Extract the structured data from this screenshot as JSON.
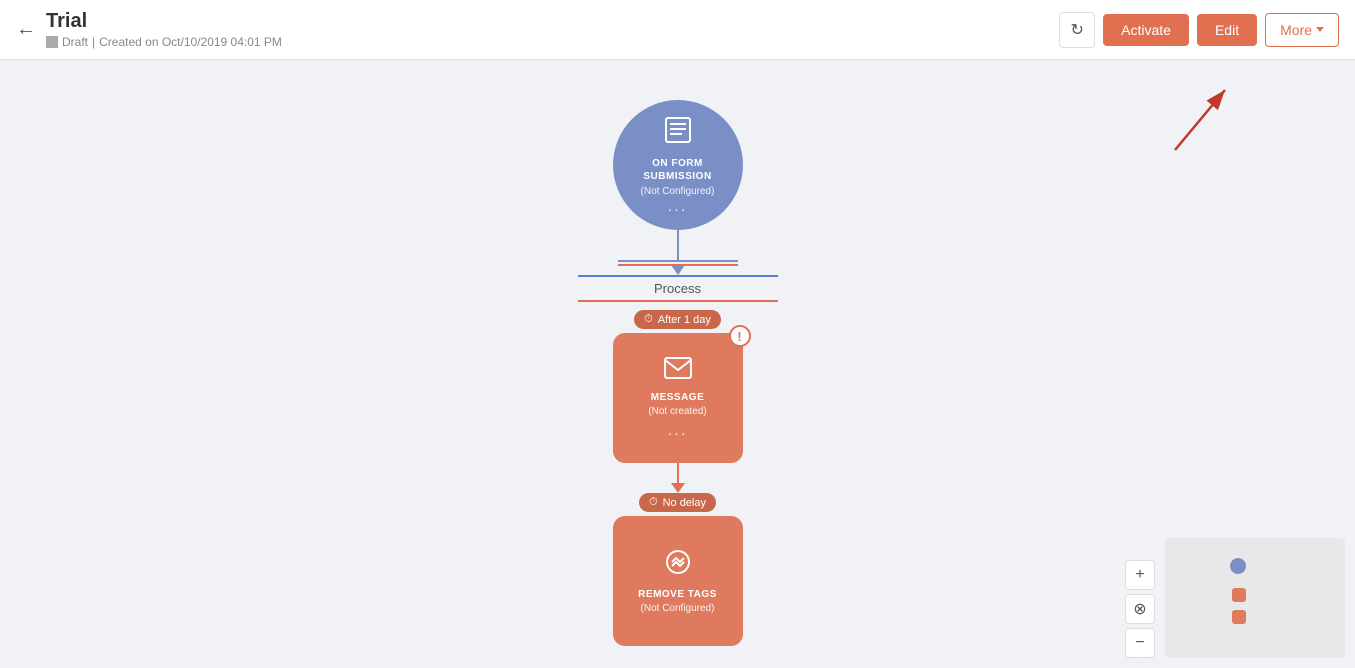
{
  "header": {
    "title": "Trial",
    "back_label": "←",
    "draft_label": "Draft",
    "separator": "|",
    "created_label": "Created on Oct/10/2019 04:01 PM",
    "refresh_icon": "↻",
    "activate_label": "Activate",
    "edit_label": "Edit",
    "more_label": "More"
  },
  "flow": {
    "trigger": {
      "icon": "☰",
      "label": "ON FORM\nSUBMISSION",
      "sub_label": "(Not Configured)",
      "dots": "···"
    },
    "process_label": "Process",
    "message_node": {
      "delay_label": "After 1 day",
      "icon": "✉",
      "label": "MESSAGE",
      "sub_label": "(Not created)",
      "dots": "···",
      "has_error": true,
      "error_symbol": "!"
    },
    "remove_tags_node": {
      "delay_label": "No delay",
      "icon": "🏷",
      "label": "REMOVE TAGS",
      "sub_label": "(Not Configured)"
    }
  },
  "minimap": {
    "visible": true
  },
  "zoom": {
    "zoom_in_label": "+",
    "zoom_reset_label": "⊗",
    "zoom_out_label": "−"
  }
}
